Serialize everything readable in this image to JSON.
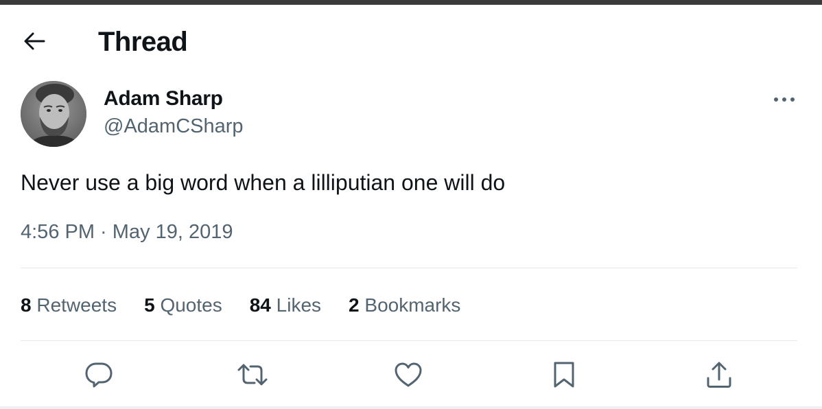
{
  "header": {
    "title": "Thread",
    "back_icon": "arrow-left-icon"
  },
  "author": {
    "name": "Adam Sharp",
    "handle": "@AdamCSharp",
    "avatar": "avatar-photo"
  },
  "tweet": {
    "text": "Never use a big word when a lilliputian one will do",
    "time": "4:56 PM",
    "separator": " · ",
    "date": "May 19, 2019"
  },
  "stats": {
    "retweets": {
      "count": "8",
      "label": "Retweets"
    },
    "quotes": {
      "count": "5",
      "label": "Quotes"
    },
    "likes": {
      "count": "84",
      "label": "Likes"
    },
    "bookmarks": {
      "count": "2",
      "label": "Bookmarks"
    }
  },
  "actions": [
    "reply-icon",
    "retweet-icon",
    "like-icon",
    "bookmark-icon",
    "share-icon"
  ],
  "colors": {
    "text_primary": "#0f1419",
    "text_secondary": "#536471",
    "divider": "#e6e9eb"
  }
}
